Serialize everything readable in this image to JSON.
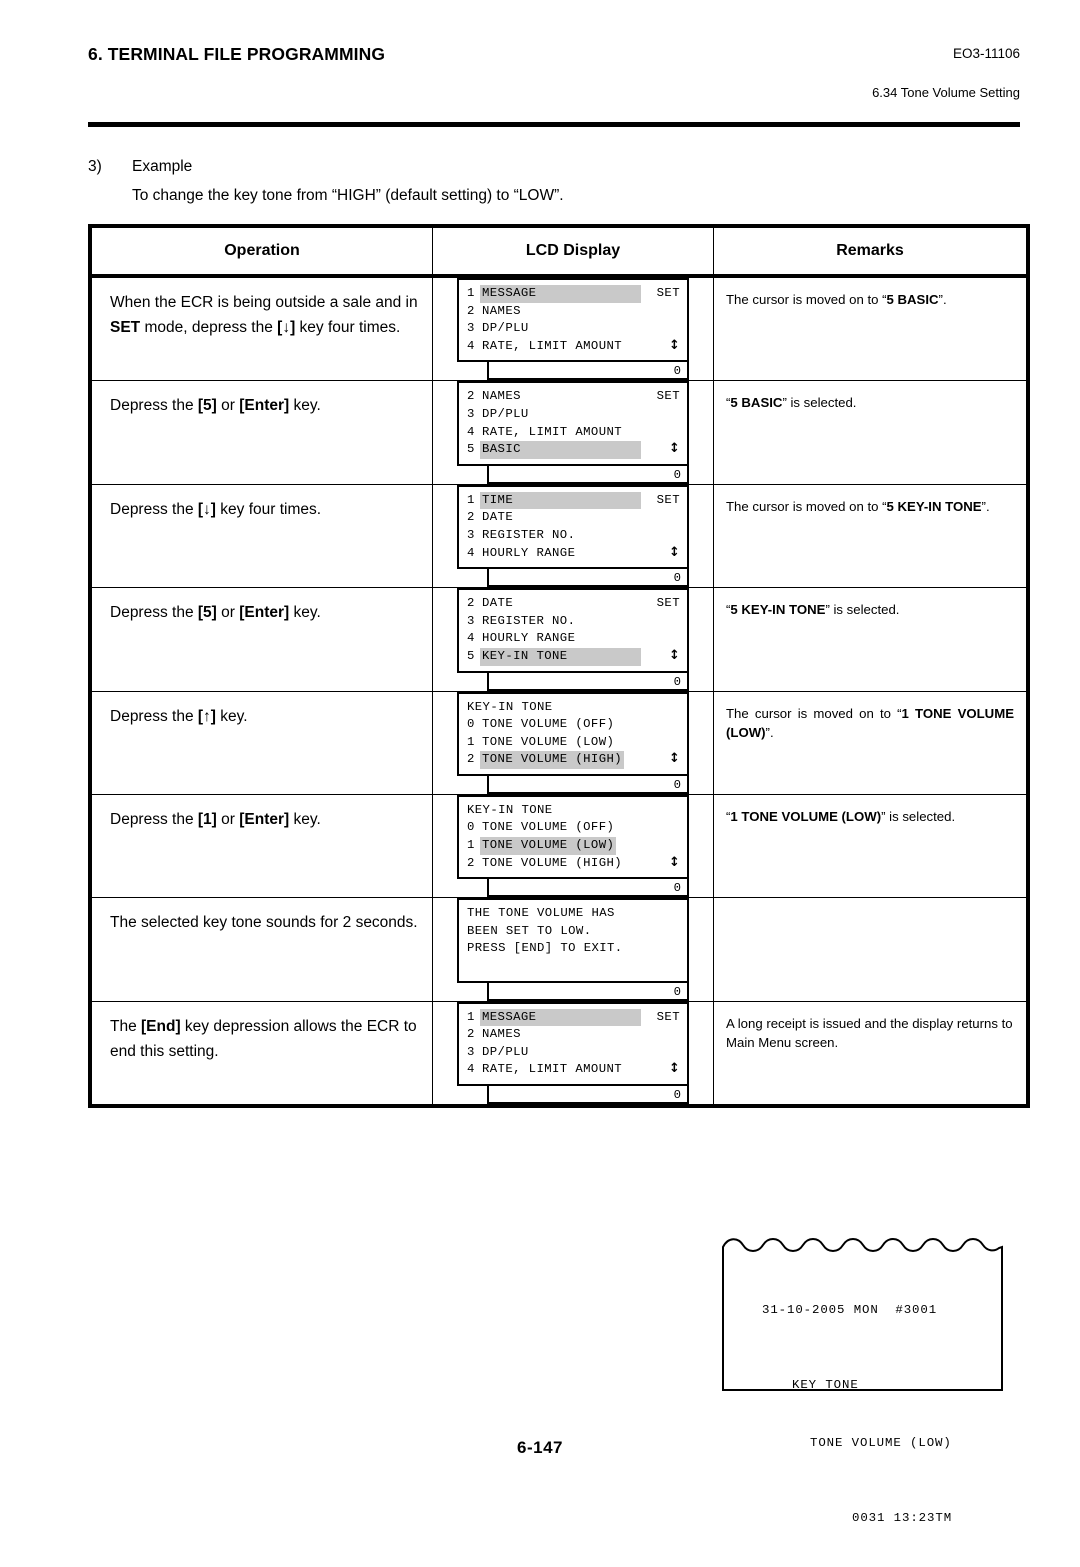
{
  "header": {
    "title": "6. TERMINAL FILE PROGRAMMING",
    "doc_code": "EO3-11106",
    "section": "6.34 Tone Volume Setting"
  },
  "intro": {
    "number": "3)",
    "label": "Example",
    "description": "To change the key tone from “HIGH” (default setting) to “LOW”."
  },
  "table": {
    "columns": [
      "Operation",
      "LCD Display",
      "Remarks"
    ],
    "rows": [
      {
        "operation_html": "When the ECR is being outside a sale and in <b>SET</b> mode, depress the <b>[↓]</b> key four times.",
        "remarks_html": "The cursor is moved on to “<b>5 BASIC</b>”.",
        "lcd": {
          "type": "menu",
          "set_label": "SET",
          "arrow": true,
          "bottom_value": "0",
          "rows": [
            {
              "index": "1",
              "label": "MESSAGE",
              "highlight": true,
              "wide": true
            },
            {
              "index": "2",
              "label": "NAMES",
              "highlight": false
            },
            {
              "index": "3",
              "label": "DP/PLU",
              "highlight": false
            },
            {
              "index": "4",
              "label": "RATE, LIMIT AMOUNT",
              "highlight": false
            }
          ]
        }
      },
      {
        "operation_html": "Depress the <b>[5]</b> or <b>[Enter]</b> key.",
        "remarks_html": "“<b>5 BASIC</b>” is selected.",
        "lcd": {
          "type": "menu",
          "set_label": "SET",
          "arrow": true,
          "bottom_value": "0",
          "rows": [
            {
              "index": "2",
              "label": "NAMES",
              "highlight": false
            },
            {
              "index": "3",
              "label": "DP/PLU",
              "highlight": false
            },
            {
              "index": "4",
              "label": "RATE, LIMIT AMOUNT",
              "highlight": false
            },
            {
              "index": "5",
              "label": "BASIC",
              "highlight": true,
              "wide": true
            }
          ]
        }
      },
      {
        "operation_html": "Depress the <b>[↓]</b> key four times.",
        "remarks_html": "The cursor is moved on to “<b>5 KEY-IN TONE</b>”.",
        "lcd": {
          "type": "menu",
          "set_label": "SET",
          "arrow": true,
          "bottom_value": "0",
          "rows": [
            {
              "index": "1",
              "label": "TIME",
              "highlight": true,
              "wide": true
            },
            {
              "index": "2",
              "label": "DATE",
              "highlight": false
            },
            {
              "index": "3",
              "label": "REGISTER NO.",
              "highlight": false
            },
            {
              "index": "4",
              "label": "HOURLY RANGE",
              "highlight": false
            }
          ]
        }
      },
      {
        "operation_html": "Depress the <b>[5]</b> or <b>[Enter]</b> key.",
        "remarks_html": "“<b>5 KEY-IN TONE</b>” is selected.",
        "lcd": {
          "type": "menu",
          "set_label": "SET",
          "arrow": true,
          "bottom_value": "0",
          "rows": [
            {
              "index": "2",
              "label": "DATE",
              "highlight": false
            },
            {
              "index": "3",
              "label": "REGISTER NO.",
              "highlight": false
            },
            {
              "index": "4",
              "label": "HOURLY RANGE",
              "highlight": false
            },
            {
              "index": "5",
              "label": "KEY-IN TONE",
              "highlight": true,
              "wide": true
            }
          ]
        }
      },
      {
        "operation_html": "Depress the <b>[↑]</b> key.",
        "remarks_html": "The cursor is moved on to “<b>1 TONE VOLUME (LOW)</b>”.",
        "remarks_justify": true,
        "lcd": {
          "type": "menu",
          "title": "KEY-IN TONE",
          "set_label": "",
          "arrow": true,
          "bottom_value": "0",
          "rows": [
            {
              "index": "0",
              "label": "TONE VOLUME (OFF)",
              "highlight": false
            },
            {
              "index": "1",
              "label": "TONE VOLUME (LOW)",
              "highlight": false
            },
            {
              "index": "2",
              "label": "TONE VOLUME (HIGH)",
              "highlight": true
            }
          ]
        }
      },
      {
        "operation_html": "Depress the <b>[1]</b> or <b>[Enter]</b> key.",
        "remarks_html": "“<b>1 TONE VOLUME (LOW)</b>” is selected.",
        "lcd": {
          "type": "menu",
          "title": "KEY-IN TONE",
          "set_label": "",
          "arrow": true,
          "bottom_value": "0",
          "rows": [
            {
              "index": "0",
              "label": "TONE VOLUME (OFF)",
              "highlight": false
            },
            {
              "index": "1",
              "label": "TONE VOLUME (LOW)",
              "highlight": true
            },
            {
              "index": "2",
              "label": "TONE VOLUME (HIGH)",
              "highlight": false
            }
          ]
        }
      },
      {
        "operation_html": "The selected key tone sounds for 2 seconds.",
        "remarks_html": "",
        "lcd": {
          "type": "message",
          "bottom_value": "0",
          "lines": [
            "THE TONE VOLUME HAS",
            "BEEN SET TO LOW.",
            "PRESS [END] TO EXIT."
          ]
        }
      },
      {
        "operation_html": "The <b>[End]</b> key depression allows the ECR to end this setting.",
        "remarks_html": "A long receipt is issued and the display returns to Main Menu screen.",
        "lcd": {
          "type": "menu",
          "set_label": "SET",
          "arrow": true,
          "bottom_value": "0",
          "rows": [
            {
              "index": "1",
              "label": "MESSAGE",
              "highlight": true,
              "wide": true
            },
            {
              "index": "2",
              "label": "NAMES",
              "highlight": false
            },
            {
              "index": "3",
              "label": "DP/PLU",
              "highlight": false
            },
            {
              "index": "4",
              "label": "RATE, LIMIT AMOUNT",
              "highlight": false
            }
          ]
        }
      }
    ]
  },
  "receipt": {
    "line1": "31-10-2005 MON  #3001",
    "line2": "KEY TONE",
    "line3": "TONE VOLUME (LOW)",
    "line4": "0031 13:23TM"
  },
  "footer": {
    "page": "6-147"
  }
}
